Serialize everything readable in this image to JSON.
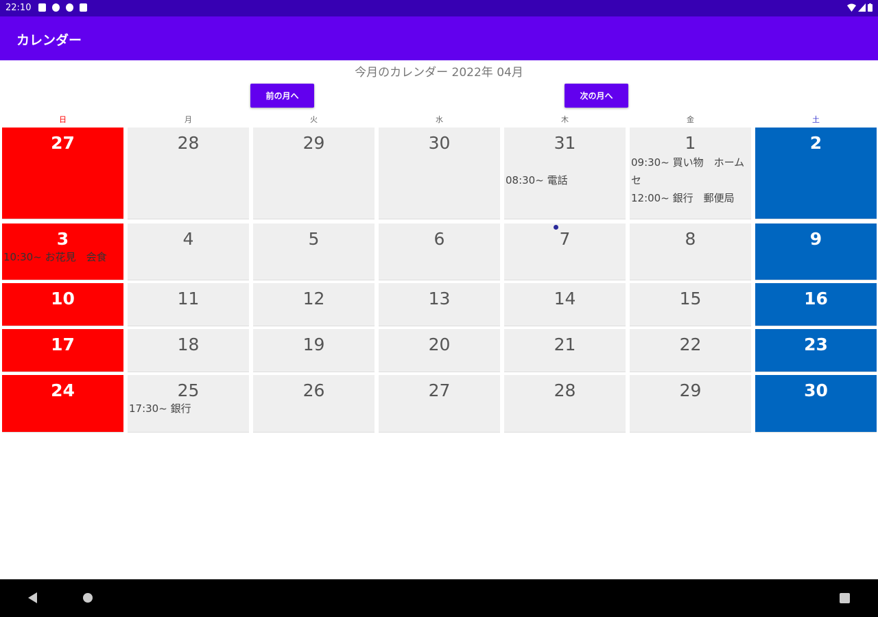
{
  "status_bar": {
    "time": "22:10",
    "icons": [
      "notification-icon",
      "download-icon",
      "f-app-icon",
      "clipboard-icon",
      "wifi-icon",
      "signal-icon",
      "battery-icon"
    ]
  },
  "app_bar": {
    "title": "カレンダー"
  },
  "month_title": "今月のカレンダー 2022年 04月",
  "nav": {
    "prev_label": "前の月へ",
    "next_label": "次の月へ"
  },
  "weekdays": [
    "日",
    "月",
    "火",
    "水",
    "木",
    "金",
    "土"
  ],
  "colors": {
    "sunday": "#ff0000",
    "saturday": "#0066c0",
    "accent": "#6200ee",
    "status": "#3700b3",
    "weekday_cell": "#efefef"
  },
  "weeks": [
    [
      {
        "day": "27",
        "events": []
      },
      {
        "day": "28",
        "events": []
      },
      {
        "day": "29",
        "events": []
      },
      {
        "day": "30",
        "events": []
      },
      {
        "day": "31",
        "events": [
          "08:30~ 電話"
        ]
      },
      {
        "day": "1",
        "events": [
          "09:30~ 買い物　ホームセ",
          "12:00~ 銀行　郵便局"
        ]
      },
      {
        "day": "2",
        "events": []
      }
    ],
    [
      {
        "day": "3",
        "events": [
          "10:30~ お花見　会食"
        ]
      },
      {
        "day": "4",
        "events": []
      },
      {
        "day": "5",
        "events": []
      },
      {
        "day": "6",
        "events": []
      },
      {
        "day": "7",
        "events": [],
        "today": true
      },
      {
        "day": "8",
        "events": []
      },
      {
        "day": "9",
        "events": []
      }
    ],
    [
      {
        "day": "10",
        "events": []
      },
      {
        "day": "11",
        "events": []
      },
      {
        "day": "12",
        "events": []
      },
      {
        "day": "13",
        "events": []
      },
      {
        "day": "14",
        "events": []
      },
      {
        "day": "15",
        "events": []
      },
      {
        "day": "16",
        "events": []
      }
    ],
    [
      {
        "day": "17",
        "events": []
      },
      {
        "day": "18",
        "events": []
      },
      {
        "day": "19",
        "events": []
      },
      {
        "day": "20",
        "events": []
      },
      {
        "day": "21",
        "events": []
      },
      {
        "day": "22",
        "events": []
      },
      {
        "day": "23",
        "events": []
      }
    ],
    [
      {
        "day": "24",
        "events": []
      },
      {
        "day": "25",
        "events": [
          "17:30~ 銀行"
        ]
      },
      {
        "day": "26",
        "events": []
      },
      {
        "day": "27",
        "events": []
      },
      {
        "day": "28",
        "events": []
      },
      {
        "day": "29",
        "events": []
      },
      {
        "day": "30",
        "events": []
      }
    ]
  ]
}
